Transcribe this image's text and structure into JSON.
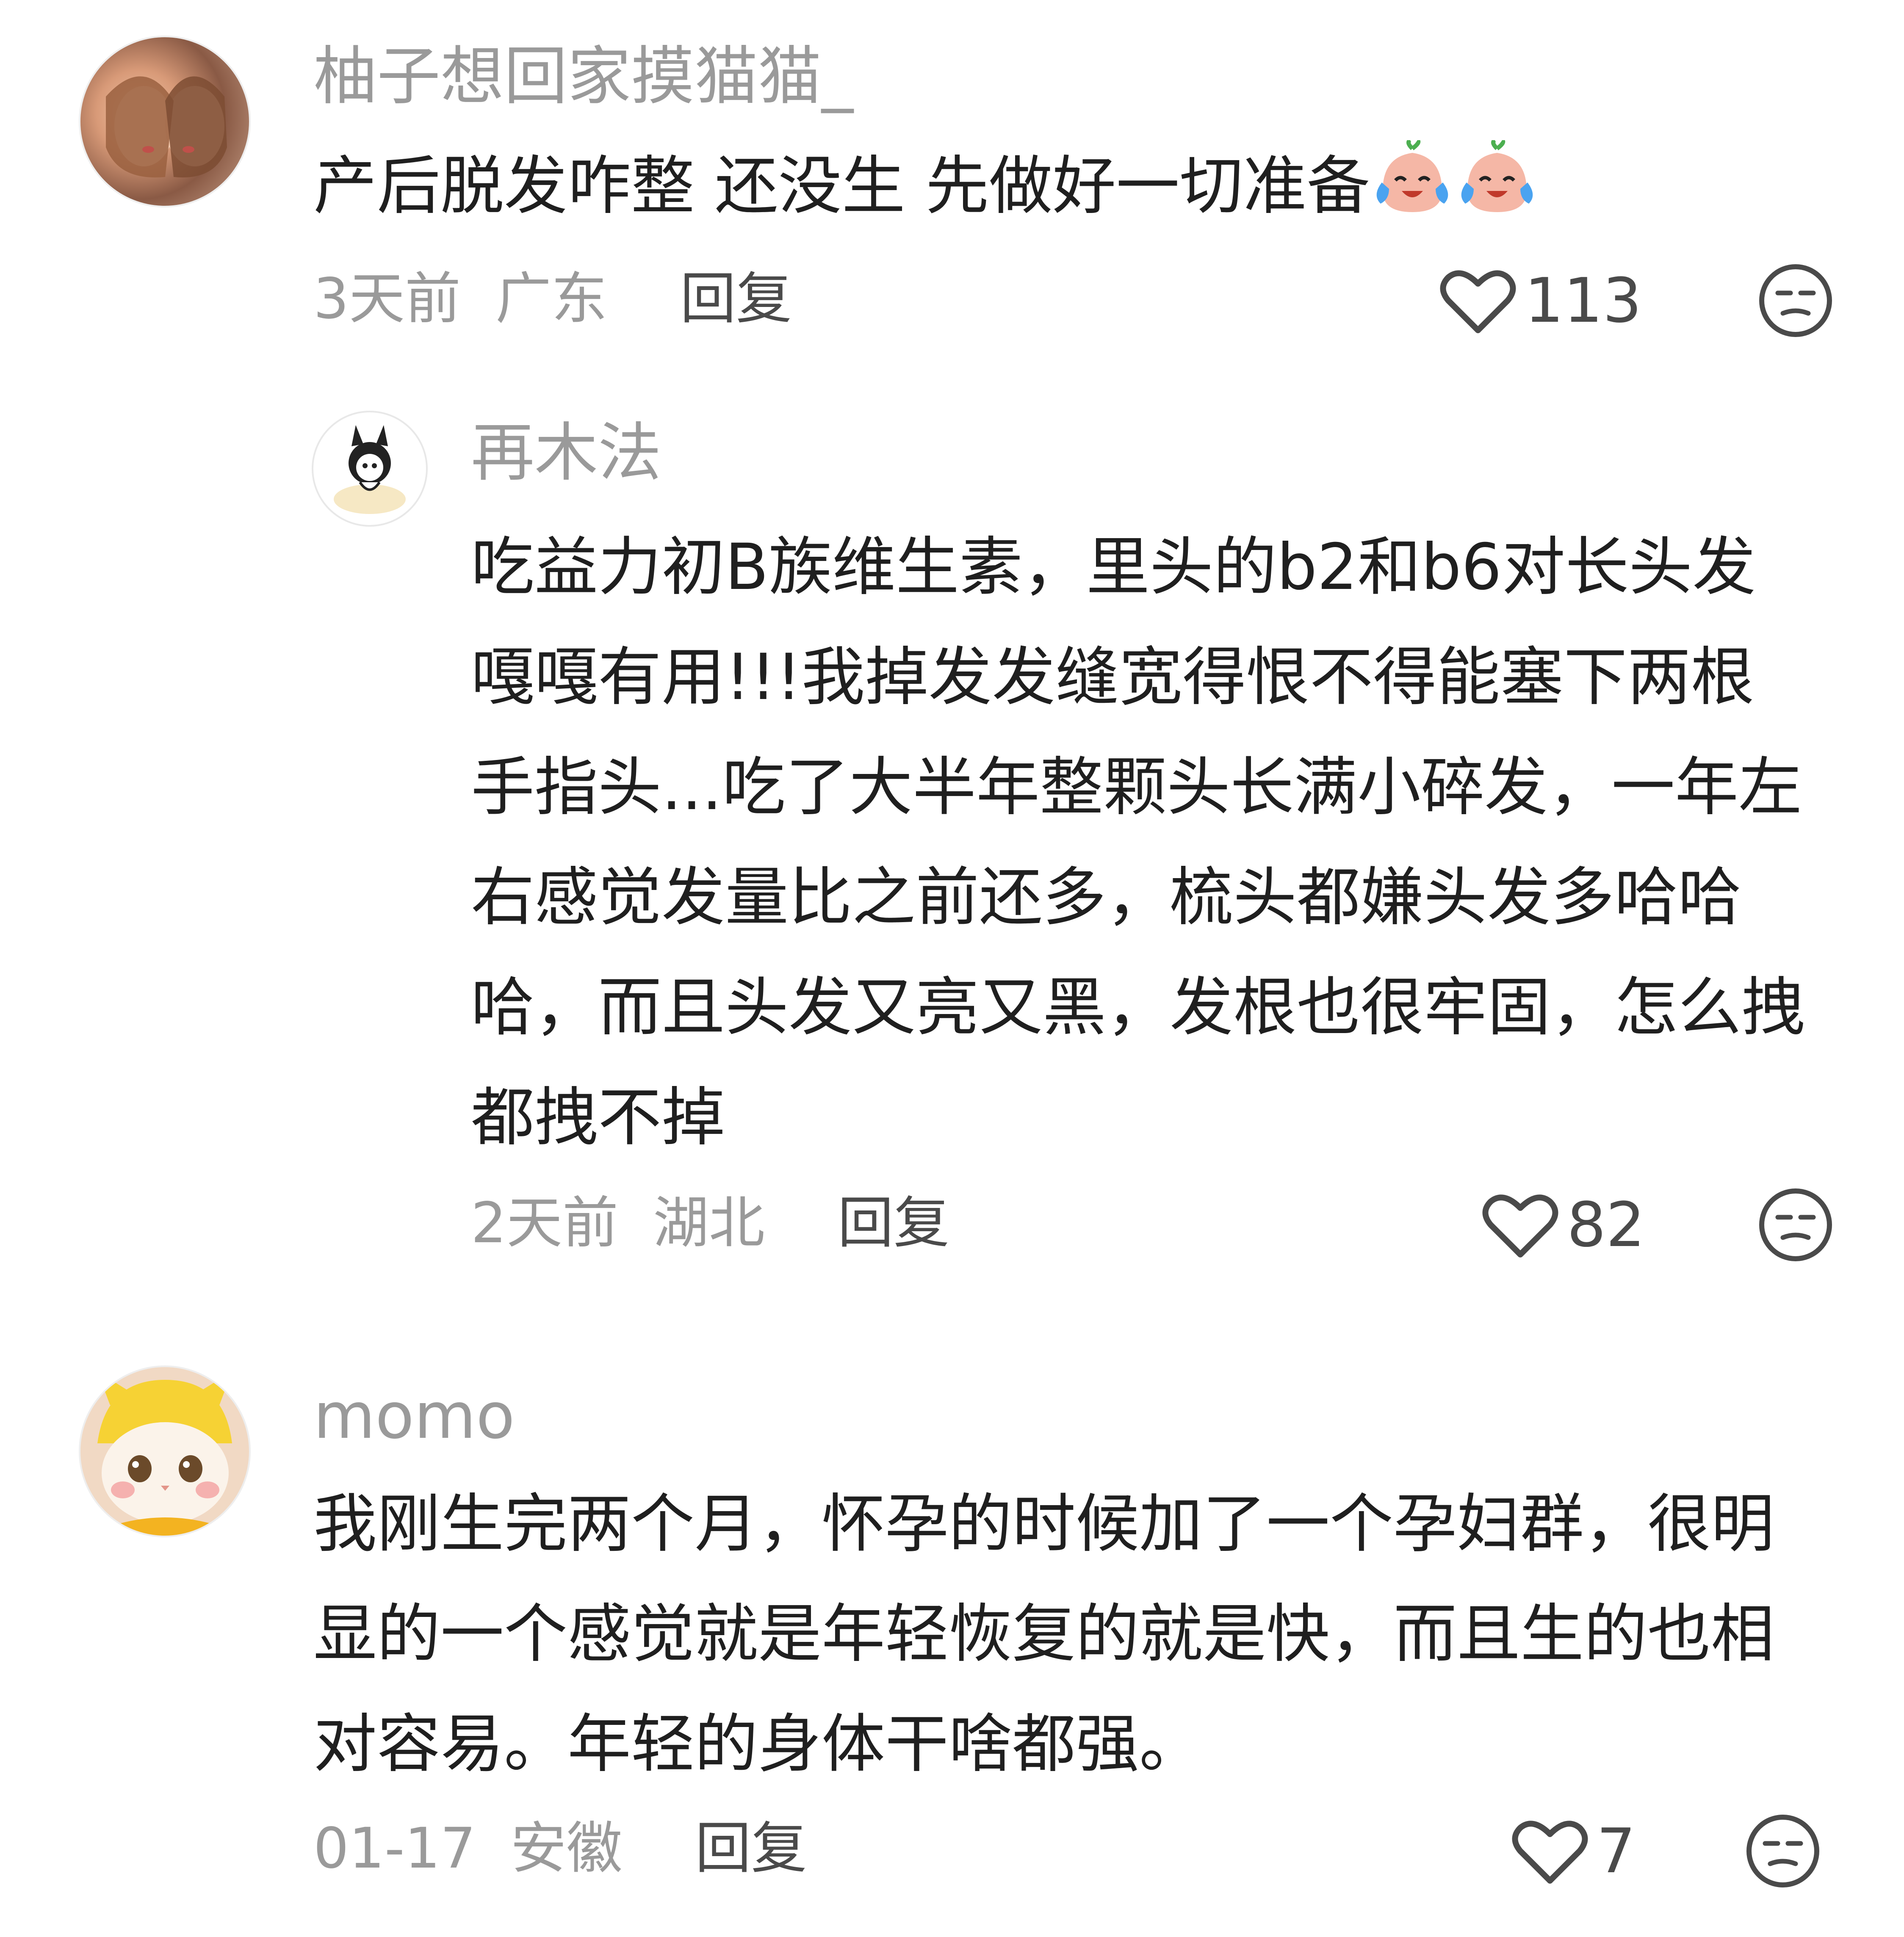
{
  "comments": [
    {
      "username": "柚子想回家摸猫猫_",
      "content": "产后脱发咋整 还没生 先做好一切准备",
      "emojis": [
        "crying-laugh-emoji",
        "crying-laugh-emoji"
      ],
      "time": "3天前",
      "location": "广东",
      "reply_label": "回复",
      "likes": "113",
      "reply": {
        "username": "再木法",
        "content": "吃益力初B族维生素，里头的b2和b6对长头发嘎嘎有用!!!我掉发发缝宽得恨不得能塞下两根手指头...吃了大半年整颗头长满小碎发，一年左右感觉发量比之前还多，梳头都嫌头发多哈哈哈，而且头发又亮又黑，发根也很牢固，怎么拽都拽不掉",
        "time": "2天前",
        "location": "湖北",
        "reply_label": "回复",
        "likes": "82"
      }
    },
    {
      "username": "momo",
      "content": "我刚生完两个月，怀孕的时候加了一个孕妇群，很明显的一个感觉就是年轻恢复的就是快，而且生的也相对容易。年轻的身体干啥都强。",
      "time": "01-17",
      "location": "安徽",
      "reply_label": "回复",
      "likes": "7"
    }
  ],
  "icons": {
    "like": "heart-outline-icon",
    "dislike": "unamused-face-icon"
  },
  "colors": {
    "username": "#9a9a9a",
    "content": "#1f1f1f",
    "meta": "#9a9a9a",
    "reply": "#4a4a4a",
    "icon": "#4a4a4a"
  }
}
